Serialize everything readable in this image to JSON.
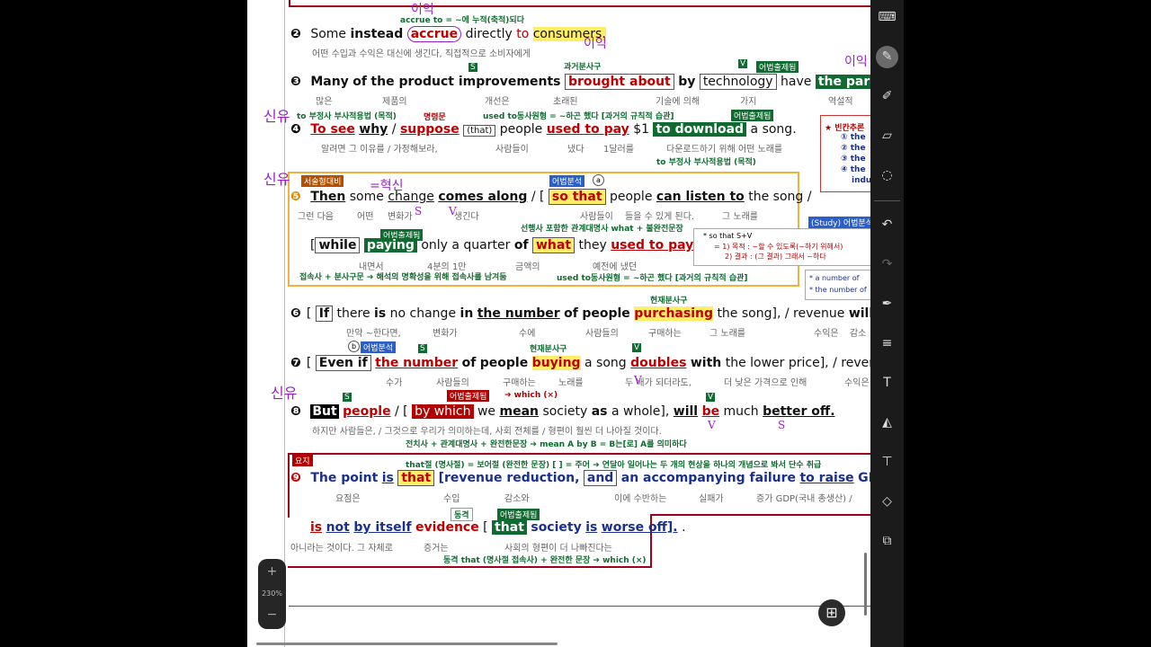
{
  "zoom": {
    "plus": "+",
    "level": "230%",
    "minus": "−"
  },
  "toolbar": [
    "keyboard-icon",
    "pen-icon",
    "highlighter-icon",
    "eraser-icon",
    "lasso-icon",
    "undo-icon",
    "redo-icon",
    "pen-settings-icon",
    "text-insert-icon",
    "text-tool-icon",
    "shape-icon",
    "text-box-icon",
    "shapes-icon",
    "copy-icon"
  ],
  "s2": {
    "num": "❷",
    "w1": "Some",
    "w2": "instead",
    "w3": "accrue",
    "w4": "directly",
    "w5": "to",
    "w6": "consumers.",
    "ko": "어떤 수입과 수익은 대신에 생긴다, 직접적으로 소비자에게",
    "note": "accrue to = ~에 누적(축적)되다",
    "pen": "이익"
  },
  "s3": {
    "num": "❸",
    "w1": "Many",
    "w2": "of",
    "w3": "the product improvements",
    "w4": "brought about",
    "w5": "by",
    "w6": "technology",
    "slash": "/",
    "w7": "have",
    "w8": "the paradoxical",
    "tag1": "과거분사구",
    "tag2": "어법출제됨",
    "ko1": "많은",
    "ko2": "제품의",
    "ko3": "개선은",
    "ko4": "초래된",
    "ko5": "기술에 의해",
    "ko6": "가지",
    "ko7": "역설적"
  },
  "s4": {
    "num": "❹",
    "w1": "To see",
    "w2": "why",
    "w3": "suppose",
    "w4": "(that)",
    "w5": "people",
    "w6": "used to pay",
    "w7": "$1",
    "w8": "to download",
    "w9": "a song.",
    "n1": "to 부정사 부사적용법 (목적)",
    "n2": "명령문",
    "n3": "used to동사원형 = ~하곤 했다 [과거의 규칙적 습관]",
    "n4": "어법출제됨",
    "n5": "to 부정사 부사적용법 (목적)",
    "ko1": "알려면 그 이유를 / 가정해보라,",
    "ko2": "사람들이",
    "ko3": "냈다",
    "ko4": "1달러를",
    "ko5": "다운로드하기 위해 어떤 노래를"
  },
  "side1": {
    "title": "★ 빈칸추론",
    "items": [
      "① the",
      "② the",
      "③ the",
      "④ the",
      "indu"
    ]
  },
  "s5": {
    "tag1": "서술형대비",
    "tag2": "어법분석",
    "circ": "a",
    "num": "❺",
    "w1": "Then",
    "w2": "some",
    "w3": "change",
    "w4": "comes along",
    "w5": "so that",
    "w6": "people",
    "w7": "can listen to",
    "w8": "the song",
    "ko1": "그런 다음",
    "ko2": "어떤",
    "ko3": "변화가",
    "ko4": "생긴다",
    "ko5": "사람들이",
    "ko6": "들을 수 있게 된다.",
    "ko7": "그 노래를",
    "n1": "선행사 포함한 관계대명사 what + 불완전문장",
    "tag3": "어법출제됨",
    "w9": "while",
    "w10": "paying",
    "w11": "only a quarter",
    "w12": "of",
    "w13": "what",
    "w14": "they",
    "w15": "used to pay",
    "ko8": "내면서",
    "ko9": "4분의 1만",
    "ko10": "금액의",
    "ko11": "예전에 냈던",
    "n2": "접속사 + 분사구문 ➔ 해석의 명확성을 위해 접속사를 남겨둠",
    "n3": "used to동사원형 = ~하곤 했다 [과거의 규칙적 습관]"
  },
  "side2": {
    "title": "(Study) 어법분석",
    "l1": "* so that S+V",
    "l2": "= 1) 목적 : ~할 수 있도록(~하기 위해서)",
    "l3": "2) 결과 : (그 결과) 그래서 ~하다",
    "l4": "* a number of",
    "l5": "* the number of"
  },
  "s6": {
    "num": "❻",
    "w1": "If",
    "w2": "there",
    "w3": "is",
    "w4": "no change",
    "w5": "in",
    "w6": "the number",
    "w7": "of",
    "w8": "people",
    "w9": "purchasing",
    "w10": "the song",
    "w11": "/ revenue",
    "w12": "will",
    "tag": "현재분사구",
    "ko1": "만약 ~한다면,",
    "ko2": "변화가",
    "ko3": "수에",
    "ko4": "사람들의",
    "ko5": "구매하는",
    "ko6": "그 노래를",
    "ko7": "수익은",
    "ko8": "감소"
  },
  "s7": {
    "num": "❼",
    "circ": "b",
    "tag1": "어법분석",
    "tag2": "현재분사구",
    "w1": "Even if",
    "w2": "the number",
    "w3": "of",
    "w4": "people",
    "w5": "buying",
    "w6": "a song",
    "w7": "doubles",
    "w8": "with",
    "w9": "the lower price",
    "w10": "/ revenue",
    "ko1": "수가",
    "ko2": "사람들의",
    "ko3": "구매하는",
    "ko4": "노래를",
    "ko5": "두 배가 되더라도,",
    "ko6": "더 낮은 가격으로 인해",
    "ko7": "수익은"
  },
  "s8": {
    "num": "❽",
    "w1": "But",
    "w2": "people",
    "w3": "by which",
    "w4": "we",
    "w5": "mean",
    "w6": "society",
    "w7": "as",
    "w8": "a whole",
    "w9": "will",
    "w10": "be",
    "w11": "much",
    "w12": "better off.",
    "tag": "어법출제됨",
    "n0": "➔ which (×)",
    "ko": "하지만 사람들은, / 그것으로 우리가 의미하는데, 사회 전체를 / 형편이 훨씬 더 나아질 것이다.",
    "n1": "전치사 + 관계대명사 + 완전한문장 ➔ mean A by B = B는[로] A를 의미하다"
  },
  "s9": {
    "label": "요지",
    "n1": "that절 (명사절) = 보어절 (완전한 문장)  [ ] = 주어 ➔ 연달아 일어나는 두 개의 현상을 하나의 개념으로 봐서 단수 취급",
    "num": "❾",
    "w1": "The point",
    "w2": "is",
    "w3": "that",
    "w4": "[revenue reduction,",
    "w5": "and",
    "w6": "an accompanying failure",
    "w7": "to raise",
    "w8": "GDP],",
    "w9": "/",
    "ko1": "요점은",
    "ko2": "수입",
    "ko3": "감소와",
    "ko4": "이에 수반하는",
    "ko5": "실패가",
    "ko6": "증가 GDP(국내 총생산) /",
    "w10": "is",
    "w11": "not",
    "w12": "by itself",
    "w13": "evidence",
    "w14": "that",
    "w15": "society",
    "w16": "is",
    "w17": "worse off].",
    "tag1": "동격",
    "tag2": "어법출제됨",
    "ko7": "아니라는 것이다. 그 자체로",
    "ko8": "증거는",
    "ko9": "사회의 형편이 더 나빠진다는",
    "n2": "동격 that (명사절 접속사) + 완전한 문장 ➔ which (×)"
  },
  "pen": [
    "이익",
    "이익",
    "신유",
    "신유",
    "신유",
    "=혁신",
    "이익",
    "S",
    "V",
    "V",
    "S",
    "V"
  ]
}
